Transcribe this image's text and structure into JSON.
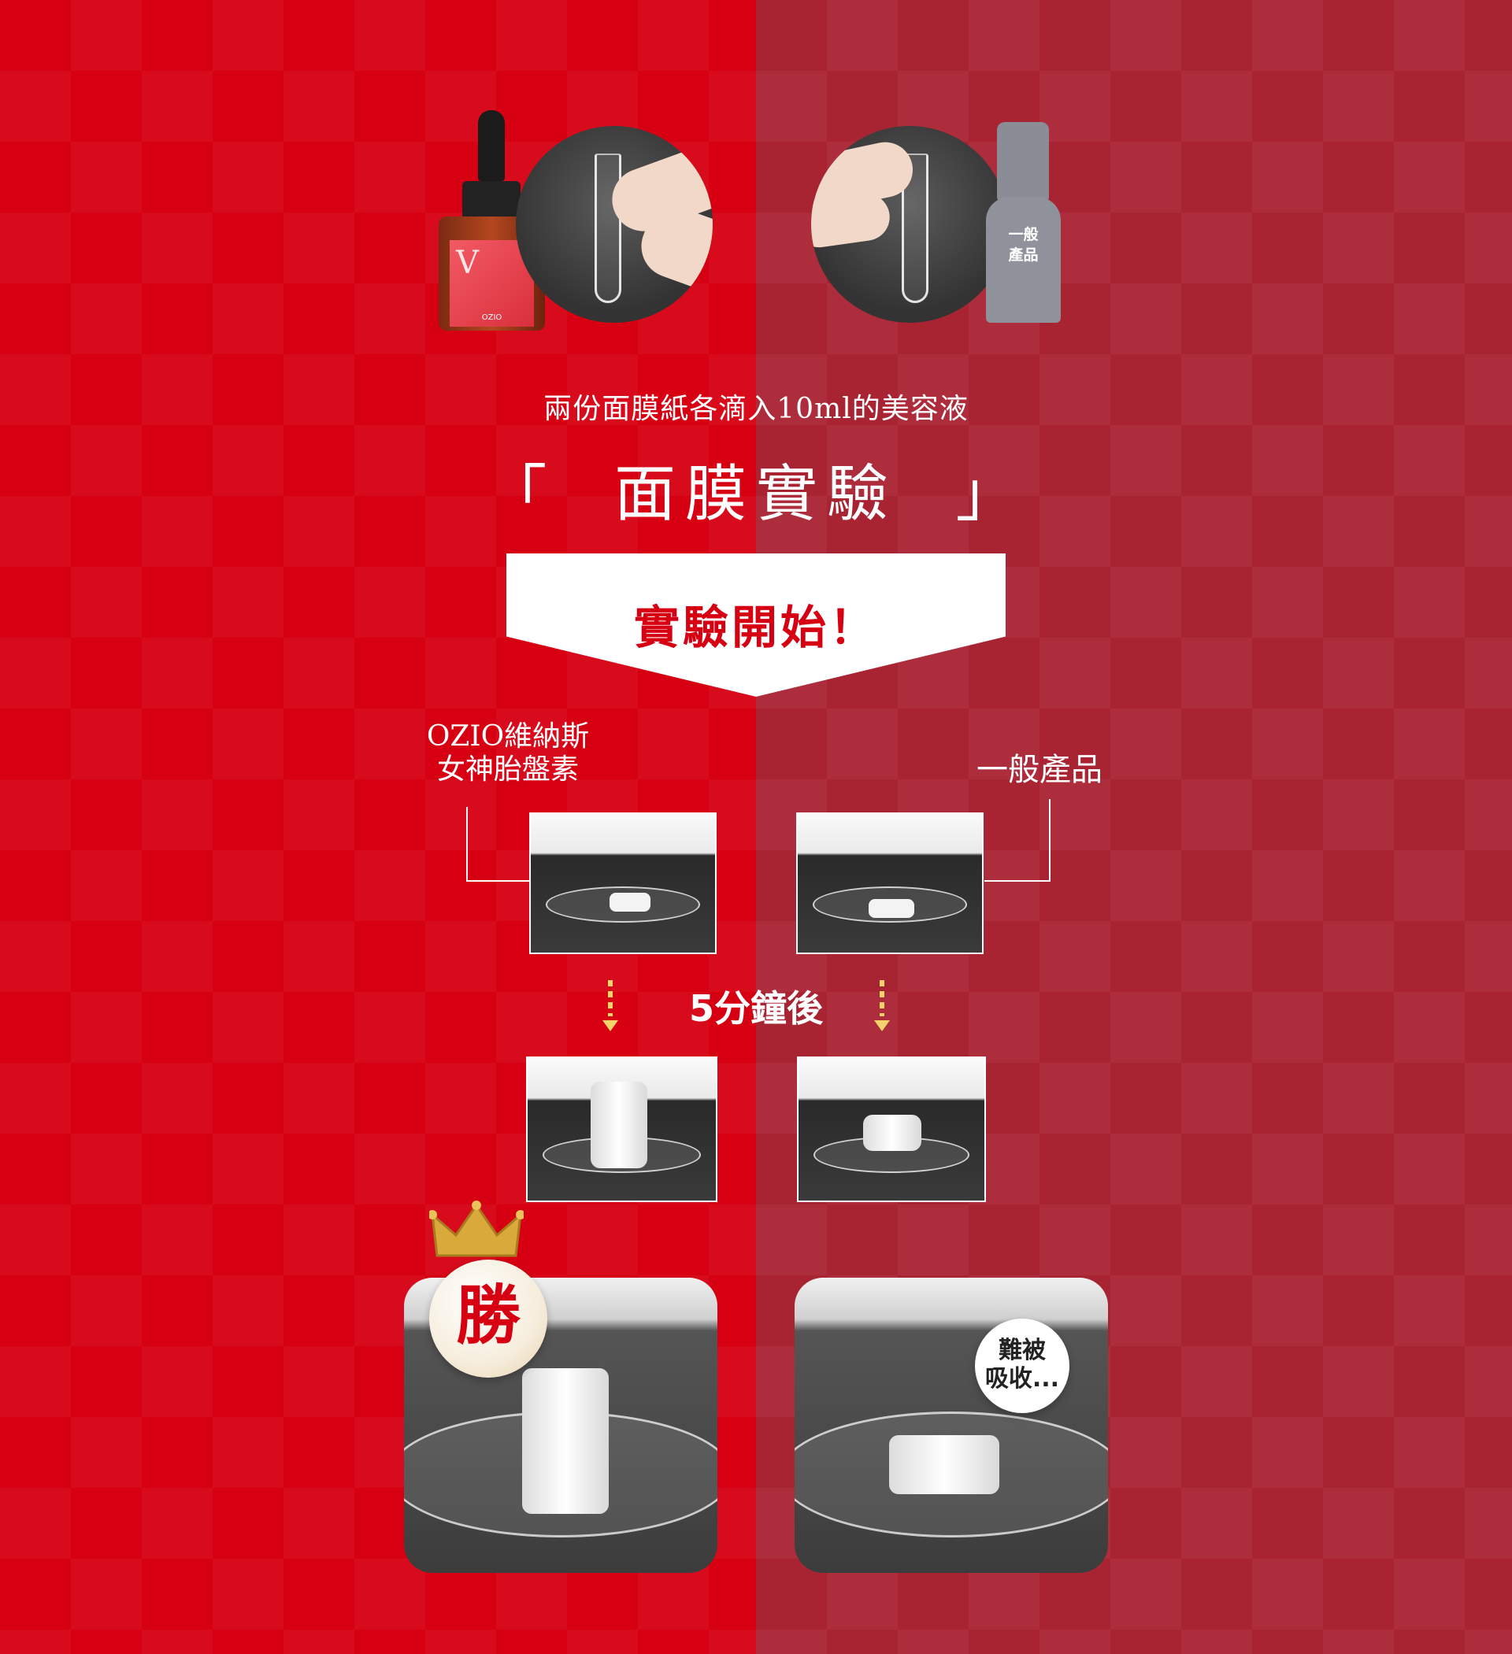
{
  "top": {
    "ozio_bottle": {
      "brand_label": "OZIO",
      "mark": "V"
    },
    "general_bottle_label": "一般\n產品"
  },
  "subtitle": "兩份面膜紙各滴入10ml的美容液",
  "title": "「  面膜實驗  」",
  "banner": "實驗開始！",
  "labels": {
    "left": "OZIO維納斯\n女神胎盤素",
    "right": "一般產品"
  },
  "after": "5分鐘後",
  "results": {
    "win": "勝",
    "hard_to_absorb": "難被\n吸收..."
  },
  "colors": {
    "left_bg": "#d60012",
    "right_bg": "#a92433",
    "accent_yellow": "#f3d36a",
    "banner_text": "#d60012"
  }
}
